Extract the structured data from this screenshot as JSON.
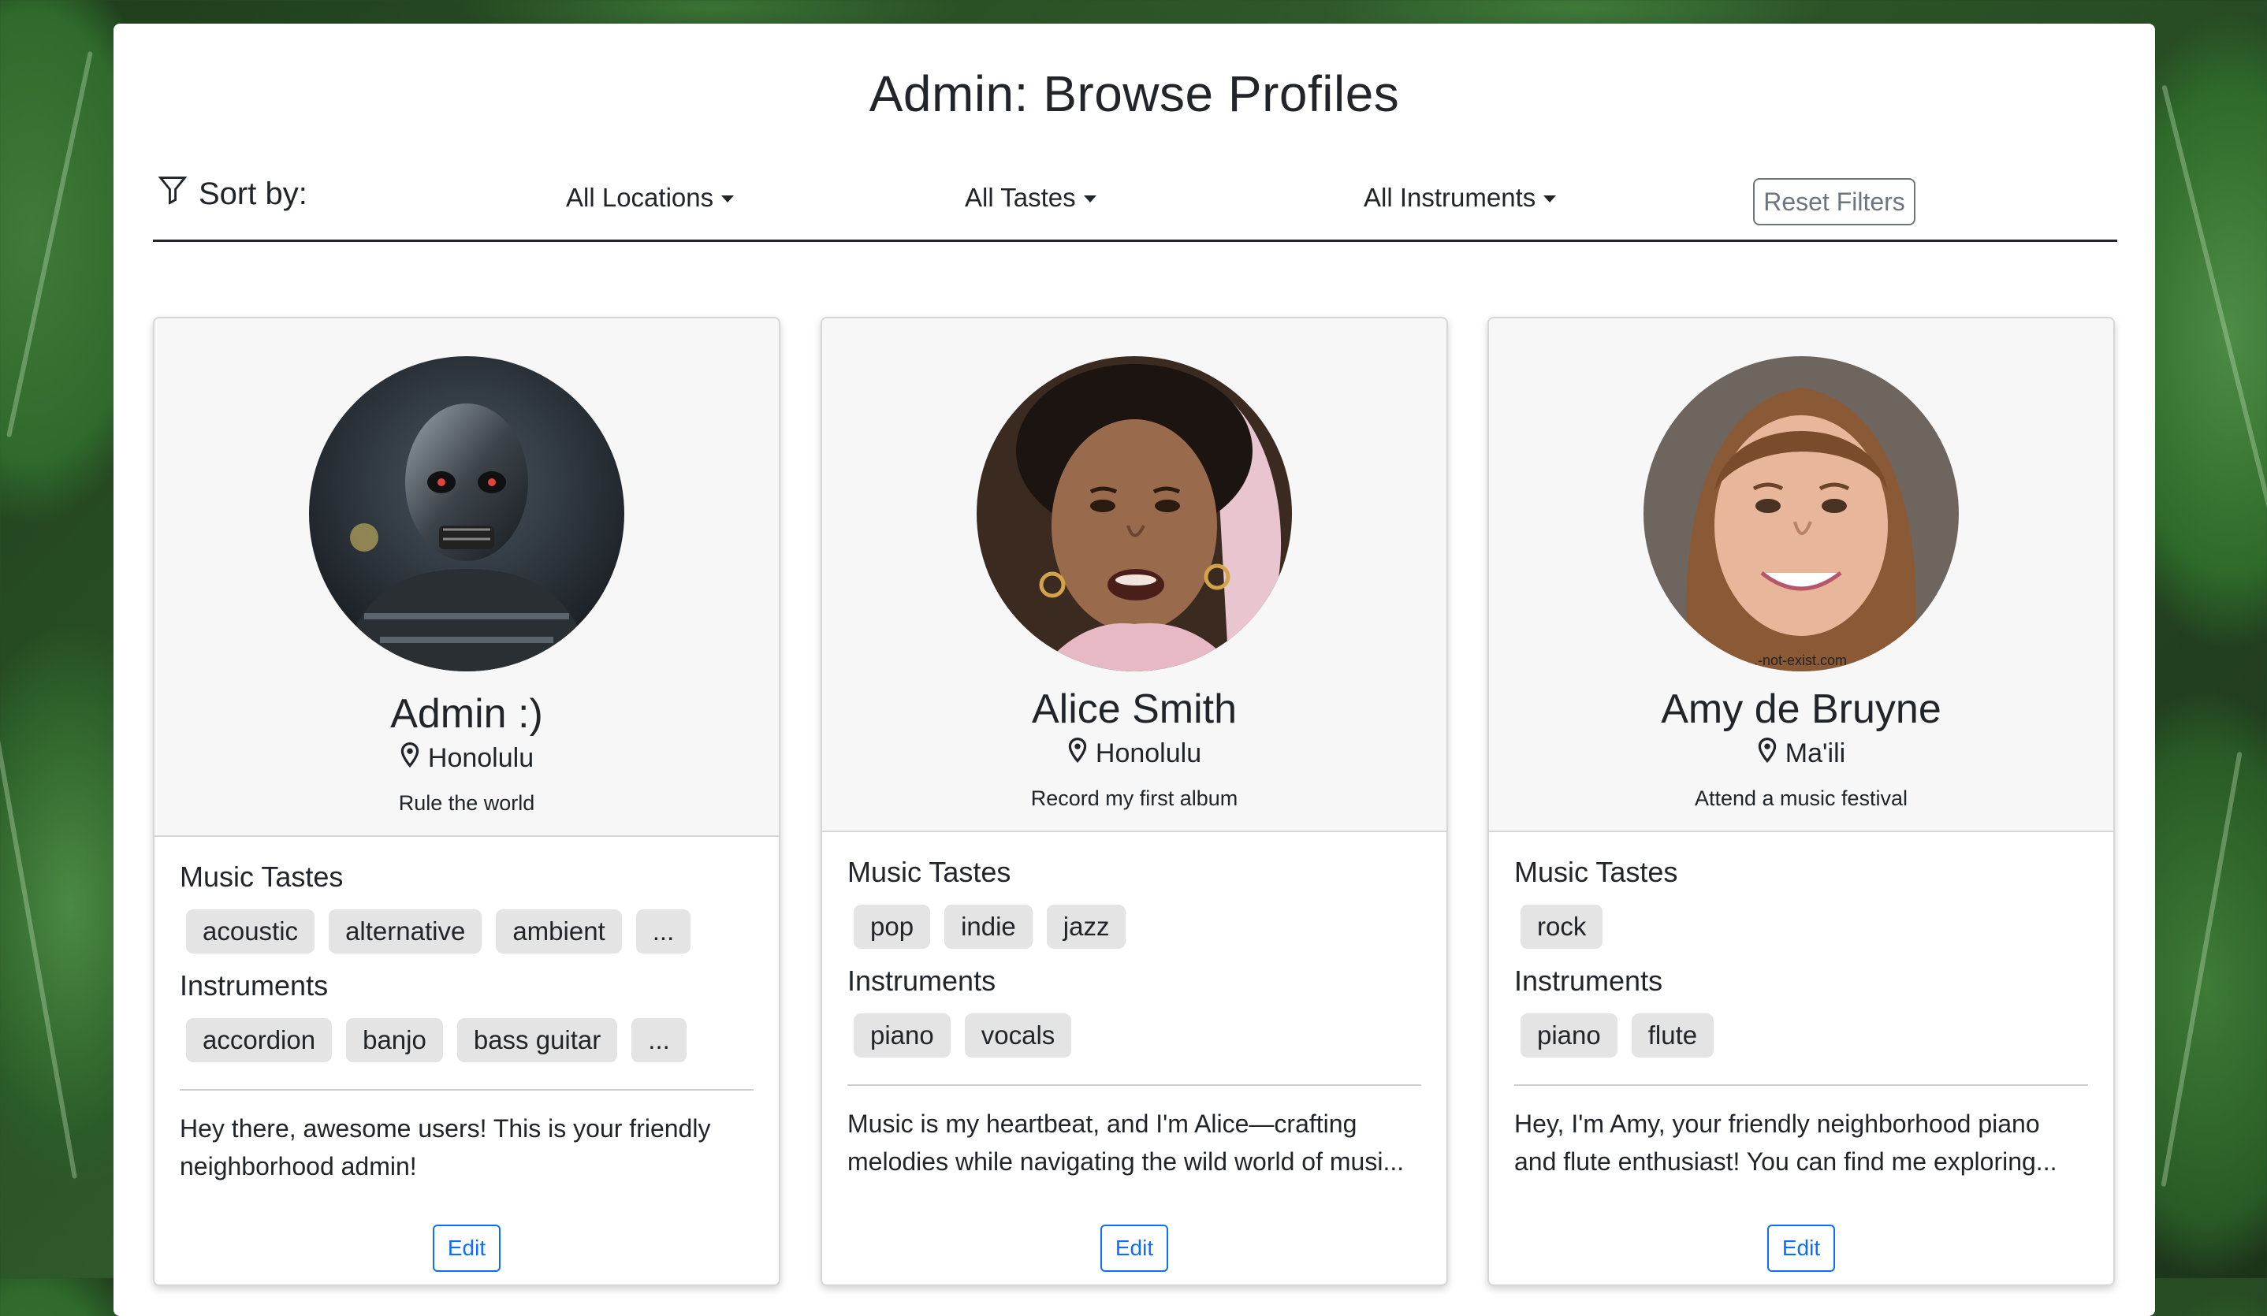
{
  "page": {
    "title": "Admin: Browse Profiles"
  },
  "filters": {
    "sort_label": "Sort by:",
    "locations": "All Locations",
    "tastes": "All Tastes",
    "instruments": "All Instruments",
    "reset": "Reset Filters"
  },
  "labels": {
    "music_tastes": "Music Tastes",
    "instruments": "Instruments",
    "edit": "Edit"
  },
  "profiles": [
    {
      "name": "Admin :)",
      "location": "Honolulu",
      "goal": "Rule the world",
      "tastes": [
        "acoustic",
        "alternative",
        "ambient",
        "..."
      ],
      "instruments": [
        "accordion",
        "banjo",
        "bass guitar",
        "..."
      ],
      "bio": "Hey there, awesome users! This is your friendly neighborhood admin!"
    },
    {
      "name": "Alice Smith",
      "location": "Honolulu",
      "goal": "Record my first album",
      "tastes": [
        "pop",
        "indie",
        "jazz"
      ],
      "instruments": [
        "piano",
        "vocals"
      ],
      "bio": "Music is my heartbeat, and I'm Alice—crafting melodies while navigating the wild world of musi..."
    },
    {
      "name": "Amy de Bruyne",
      "location": "Ma'ili",
      "goal": "Attend a music festival",
      "tastes": [
        "rock"
      ],
      "instruments": [
        "piano",
        "flute"
      ],
      "bio": "Hey, I'm Amy, your friendly neighborhood piano and flute enthusiast! You can find me exploring..."
    }
  ],
  "colors": {
    "primary": "#0d6efd",
    "secondary": "#6c757d",
    "tag_bg": "#e4e4e4",
    "card_head_bg": "#f7f7f7"
  }
}
